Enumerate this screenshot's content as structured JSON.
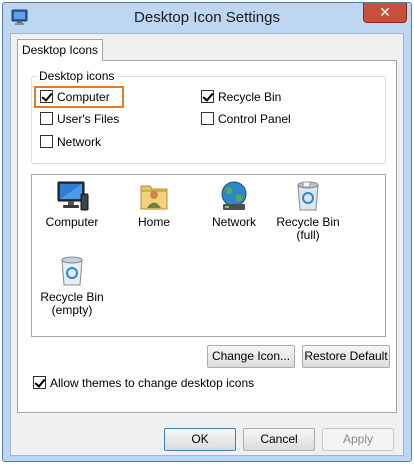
{
  "window": {
    "title": "Desktop Icon Settings"
  },
  "titlebar": {
    "close_glyph": "✕"
  },
  "tabs": [
    {
      "label": "Desktop Icons"
    }
  ],
  "group": {
    "legend": "Desktop icons",
    "checkboxes": [
      {
        "label": "Computer",
        "checked": true
      },
      {
        "label": "User's Files",
        "checked": false
      },
      {
        "label": "Network",
        "checked": false
      },
      {
        "label": "Recycle Bin",
        "checked": true
      },
      {
        "label": "Control Panel",
        "checked": false
      }
    ]
  },
  "icons": [
    {
      "label": "Computer",
      "icon": "computer-icon"
    },
    {
      "label": "Home",
      "icon": "home-folder-icon"
    },
    {
      "label": "Network",
      "icon": "network-globe-icon"
    },
    {
      "label": "Recycle Bin\n(full)",
      "line1": "Recycle Bin",
      "line2": "(full)",
      "icon": "recycle-bin-full-icon"
    },
    {
      "label": "Recycle Bin\n(empty)",
      "line1": "Recycle Bin",
      "line2": "(empty)",
      "icon": "recycle-bin-empty-icon"
    }
  ],
  "buttons": {
    "change_icon": "Change Icon...",
    "restore_default": "Restore Default",
    "ok": "OK",
    "cancel": "Cancel",
    "apply": "Apply"
  },
  "allow_themes": {
    "label": "Allow themes to change desktop icons",
    "checked": true
  },
  "colors": {
    "title_bar": "#bdd7f2",
    "close_button": "#c74f3c",
    "focus_ring": "#e07b2a"
  }
}
